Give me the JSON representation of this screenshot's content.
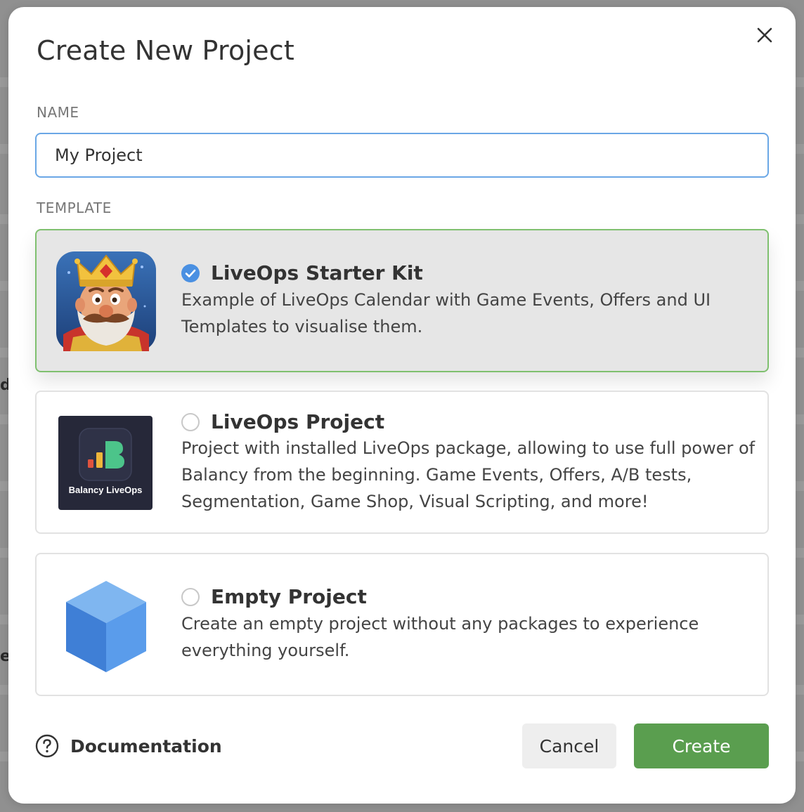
{
  "dialog": {
    "title": "Create New Project",
    "close_label": "×"
  },
  "name_section": {
    "label": "NAME",
    "value": "My Project",
    "placeholder": ""
  },
  "template_section": {
    "label": "TEMPLATE",
    "templates": [
      {
        "title": "LiveOps Starter Kit",
        "description": "Example of LiveOps Calendar with Game Events, Offers and UI Templates to visualise them.",
        "selected": true,
        "icon": "king-character-icon"
      },
      {
        "title": "LiveOps Project",
        "description": "Project with installed LiveOps package, allowing to use full power of Balancy from the beginning. Game Events, Offers, A/B tests, Segmentation, Game Shop, Visual Scripting, and more!",
        "selected": false,
        "icon": "balancy-liveops-logo",
        "logo_caption": "Balancy LiveOps"
      },
      {
        "title": "Empty Project",
        "description": "Create an empty project without any packages to experience everything yourself.",
        "selected": false,
        "icon": "blue-cube-icon"
      }
    ]
  },
  "footer": {
    "documentation_label": "Documentation",
    "cancel_label": "Cancel",
    "create_label": "Create"
  },
  "background": {
    "edge_chars": [
      "d",
      "e"
    ]
  },
  "colors": {
    "accent_blue": "#4a90e2",
    "selected_border": "#7fc06f",
    "create_green": "#5a9e4f"
  }
}
